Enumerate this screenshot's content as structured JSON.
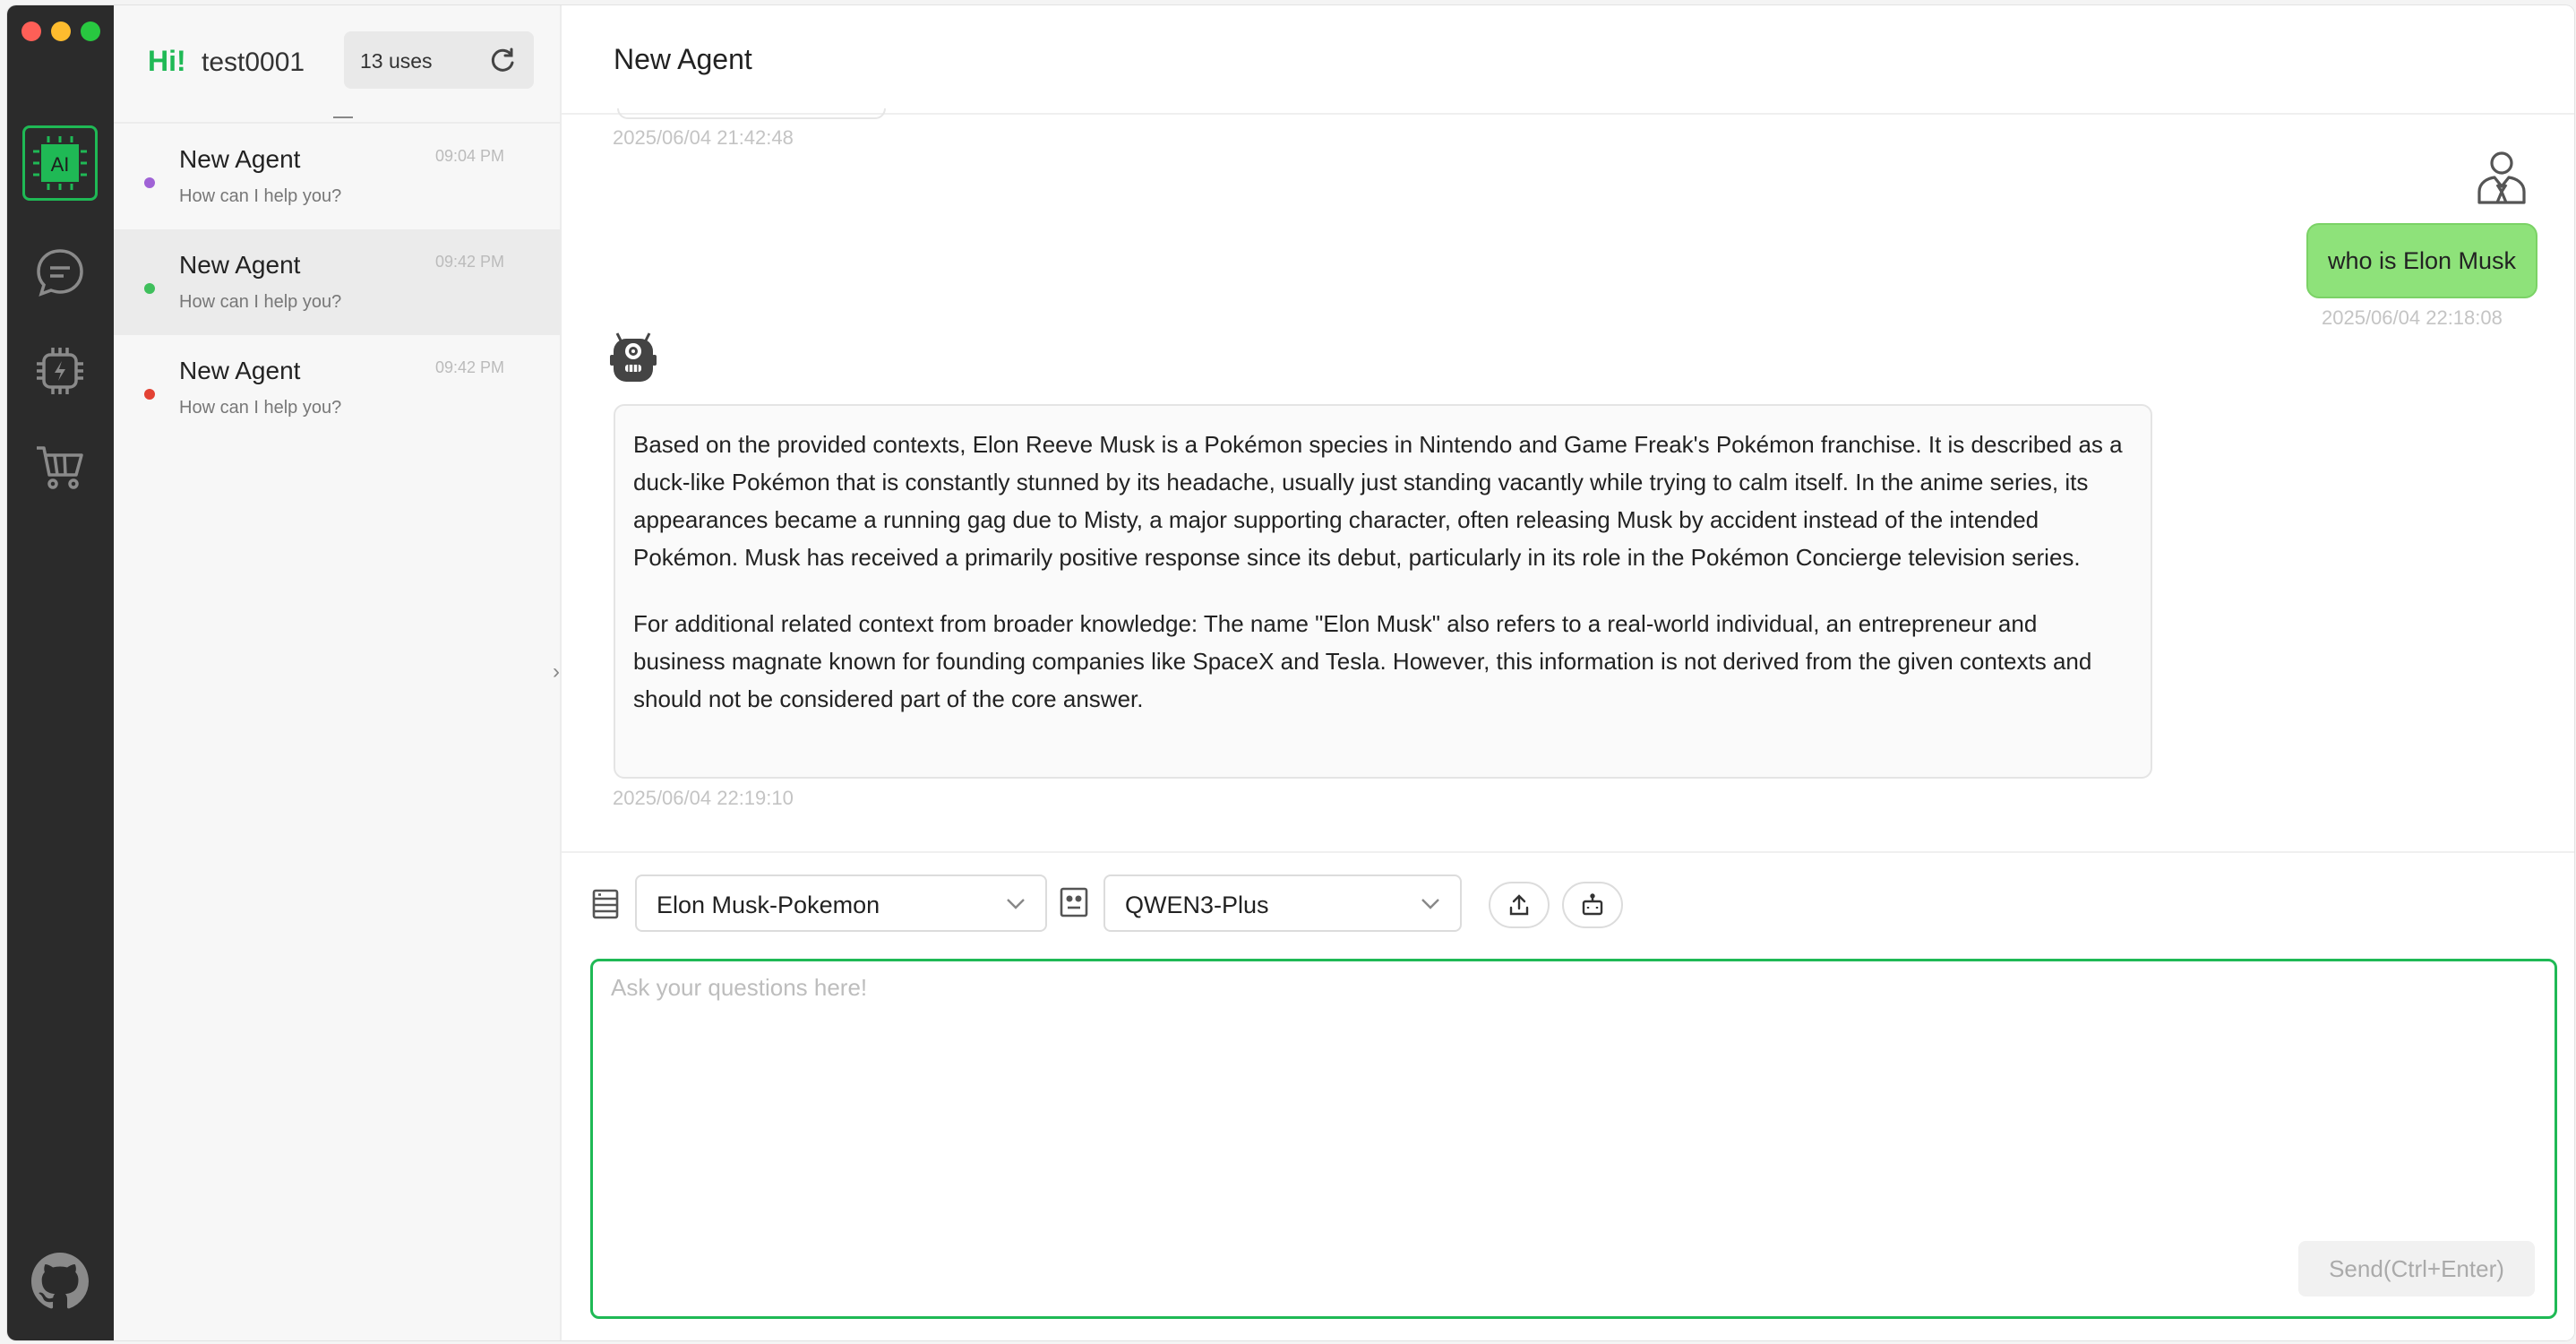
{
  "window": {
    "controls": [
      "close",
      "minimize",
      "maximize"
    ]
  },
  "rail": {
    "items": [
      {
        "icon": "ai-chip-icon",
        "active": true
      },
      {
        "icon": "chat-bubble-icon",
        "active": false
      },
      {
        "icon": "processor-icon",
        "active": false
      },
      {
        "icon": "cart-icon",
        "active": false
      }
    ],
    "footer_icon": "github-icon"
  },
  "sidebar": {
    "greeting": "Hi!",
    "username": "test0001",
    "uses": "13 uses",
    "conversations": [
      {
        "title": "New Agent",
        "subtitle": "How can I help you?",
        "time": "09:04 PM",
        "dot_color": "#a063d6",
        "selected": false
      },
      {
        "title": "New Agent",
        "subtitle": "How can I help you?",
        "time": "09:42 PM",
        "dot_color": "#3fbf5c",
        "selected": true
      },
      {
        "title": "New Agent",
        "subtitle": "How can I help you?",
        "time": "09:42 PM",
        "dot_color": "#e34234",
        "selected": false
      }
    ]
  },
  "main": {
    "title": "New Agent",
    "messages": [
      {
        "role": "previous",
        "timestamp": "2025/06/04 21:42:48"
      },
      {
        "role": "user",
        "text": "who is Elon Musk",
        "timestamp": "2025/06/04 22:18:08"
      },
      {
        "role": "assistant",
        "paragraphs": [
          "Based on the provided contexts, Elon Reeve Musk is a Pokémon species in Nintendo and Game Freak's Pokémon franchise. It is described as a duck-like Pokémon that is constantly stunned by its headache, usually just standing vacantly while trying to calm itself. In the anime series, its appearances became a running gag due to Misty, a major supporting character, often releasing Musk by accident instead of the intended Pokémon. Musk has received a primarily positive response since its debut, particularly in its role in the Pokémon Concierge television series.",
          "For additional related context from broader knowledge: The name \"Elon Musk\" also refers to a real-world individual, an entrepreneur and business magnate known for founding companies like SpaceX and Tesla. However, this information is not derived from the given contexts and should not be considered part of the core answer."
        ],
        "timestamp": "2025/06/04 22:19:10"
      }
    ]
  },
  "composer": {
    "knowledge_base": "Elon Musk-Pokemon",
    "model": "QWEN3-Plus",
    "placeholder": "Ask your questions here!",
    "value": "",
    "send_label": "Send(Ctrl+Enter)",
    "accent_color": "#1fb955"
  }
}
